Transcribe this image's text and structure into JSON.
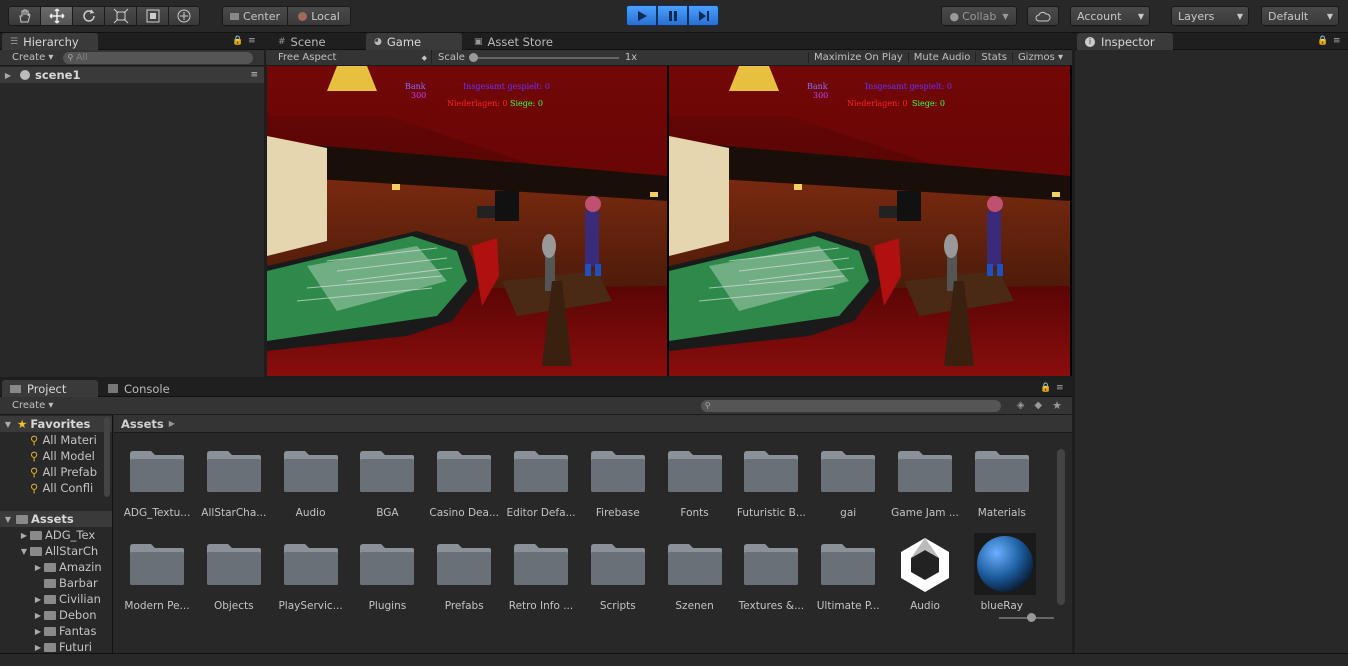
{
  "toolbar": {
    "tools": [
      "hand-tool",
      "move-tool",
      "rotate-tool",
      "scale-tool",
      "rect-tool",
      "transform-tool"
    ],
    "pivot_center": "Center",
    "pivot_local": "Local",
    "collab": "Collab",
    "account": "Account",
    "layers": "Layers",
    "layout": "Default"
  },
  "hierarchy": {
    "tab": "Hierarchy",
    "create": "Create",
    "search_placeholder": "All",
    "scene": "scene1"
  },
  "center_tabs": {
    "scene": "Scene",
    "game": "Game",
    "asset_store": "Asset Store"
  },
  "game_bar": {
    "aspect": "Free Aspect",
    "scale_label": "Scale",
    "scale_value": "1x",
    "maximize": "Maximize On Play",
    "mute": "Mute Audio",
    "stats": "Stats",
    "gizmos": "Gizmos"
  },
  "game_hud": {
    "bank_label": "Bank",
    "bank_value": "300",
    "played": "Insgesamt gespielt: 0",
    "losses": "Niederlagen: 0",
    "wins": "Siege: 0"
  },
  "inspector": {
    "tab": "Inspector"
  },
  "project": {
    "tab_project": "Project",
    "tab_console": "Console",
    "create": "Create",
    "favorites_label": "Favorites",
    "favorites": [
      "All Materi",
      "All Model",
      "All Prefab",
      "All Confli"
    ],
    "assets_label": "Assets",
    "tree": [
      {
        "label": "ADG_Tex",
        "depth": 1
      },
      {
        "label": "AllStarCh",
        "depth": 1
      },
      {
        "label": "Amazin",
        "depth": 2
      },
      {
        "label": "Barbar",
        "depth": 2
      },
      {
        "label": "Civilian",
        "depth": 2
      },
      {
        "label": "Debon",
        "depth": 2
      },
      {
        "label": "Fantas",
        "depth": 2
      },
      {
        "label": "Futuri",
        "depth": 2
      }
    ],
    "breadcrumb": "Assets",
    "items": [
      {
        "label": "ADG_Textu...",
        "kind": "folder"
      },
      {
        "label": "AllStarCha...",
        "kind": "folder"
      },
      {
        "label": "Audio",
        "kind": "folder"
      },
      {
        "label": "BGA",
        "kind": "folder"
      },
      {
        "label": "Casino Dea...",
        "kind": "folder"
      },
      {
        "label": "Editor Defa...",
        "kind": "folder"
      },
      {
        "label": "Firebase",
        "kind": "folder"
      },
      {
        "label": "Fonts",
        "kind": "folder"
      },
      {
        "label": "Futuristic B...",
        "kind": "folder"
      },
      {
        "label": "gai",
        "kind": "folder"
      },
      {
        "label": "Game Jam ...",
        "kind": "folder"
      },
      {
        "label": "Materials",
        "kind": "folder"
      },
      {
        "label": "Modern Pe...",
        "kind": "folder"
      },
      {
        "label": "Objects",
        "kind": "folder"
      },
      {
        "label": "PlayServic...",
        "kind": "folder"
      },
      {
        "label": "Plugins",
        "kind": "folder"
      },
      {
        "label": "Prefabs",
        "kind": "folder"
      },
      {
        "label": "Retro Info ...",
        "kind": "folder"
      },
      {
        "label": "Scripts",
        "kind": "folder"
      },
      {
        "label": "Szenen",
        "kind": "folder"
      },
      {
        "label": "Textures &...",
        "kind": "folder"
      },
      {
        "label": "Ultimate P...",
        "kind": "folder"
      },
      {
        "label": "Audio",
        "kind": "unity"
      },
      {
        "label": "blueRay",
        "kind": "sphere"
      }
    ]
  }
}
